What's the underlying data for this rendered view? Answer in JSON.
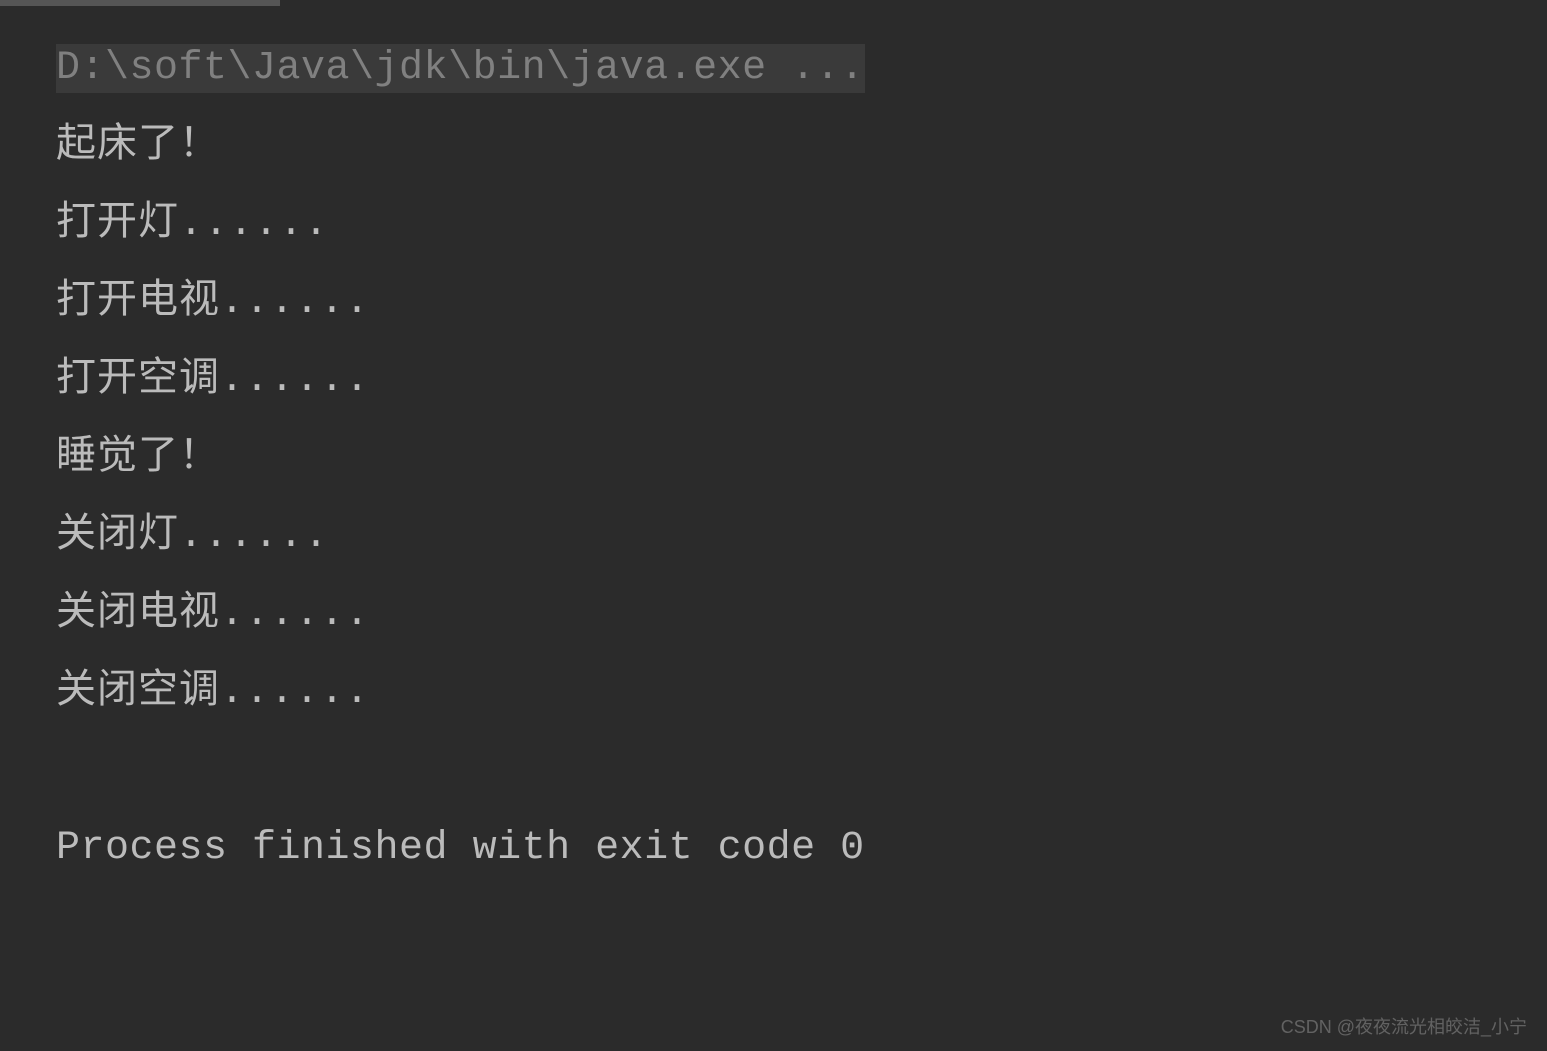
{
  "console": {
    "command": "D:\\soft\\Java\\jdk\\bin\\java.exe ...",
    "output": [
      "起床了！",
      "打开灯......",
      "打开电视......",
      "打开空调......",
      "睡觉了！",
      "关闭灯......",
      "关闭电视......",
      "关闭空调......"
    ],
    "exitMessage": "Process finished with exit code 0"
  },
  "watermark": "CSDN @夜夜流光相皎洁_小宁"
}
